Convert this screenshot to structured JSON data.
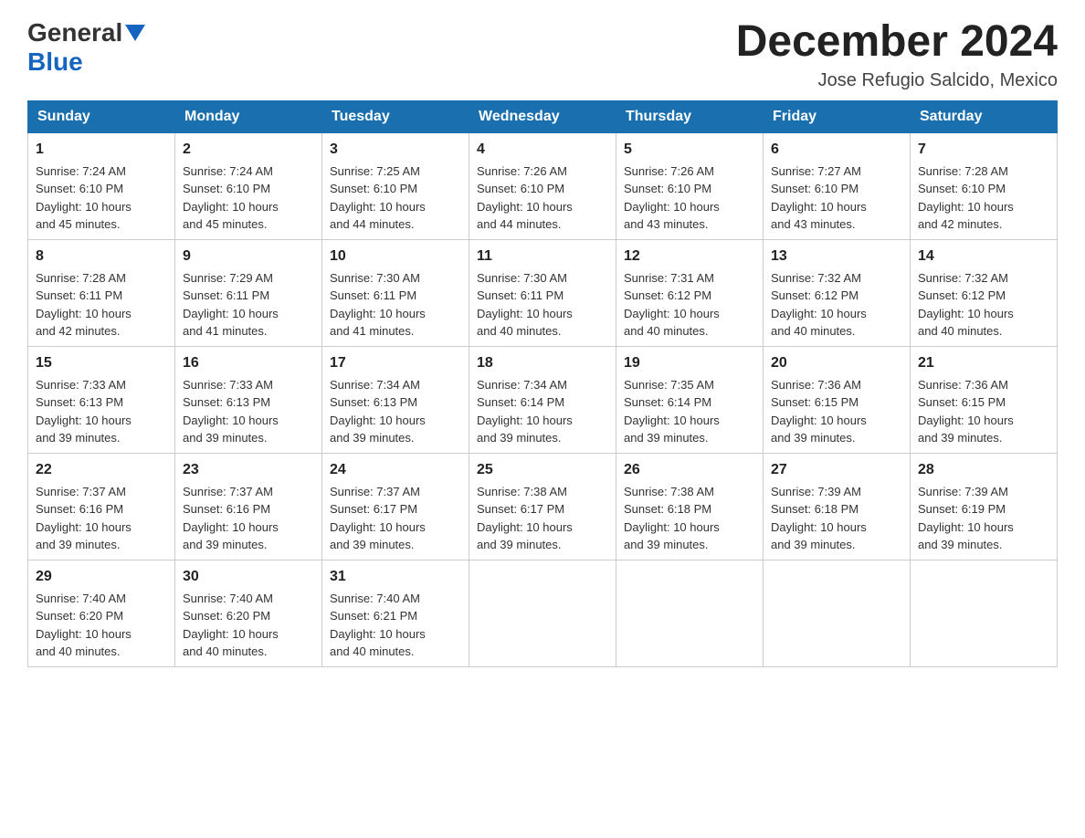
{
  "logo": {
    "general": "General",
    "blue": "Blue"
  },
  "title": "December 2024",
  "subtitle": "Jose Refugio Salcido, Mexico",
  "days_of_week": [
    "Sunday",
    "Monday",
    "Tuesday",
    "Wednesday",
    "Thursday",
    "Friday",
    "Saturday"
  ],
  "weeks": [
    [
      {
        "day": "1",
        "info": "Sunrise: 7:24 AM\nSunset: 6:10 PM\nDaylight: 10 hours\nand 45 minutes."
      },
      {
        "day": "2",
        "info": "Sunrise: 7:24 AM\nSunset: 6:10 PM\nDaylight: 10 hours\nand 45 minutes."
      },
      {
        "day": "3",
        "info": "Sunrise: 7:25 AM\nSunset: 6:10 PM\nDaylight: 10 hours\nand 44 minutes."
      },
      {
        "day": "4",
        "info": "Sunrise: 7:26 AM\nSunset: 6:10 PM\nDaylight: 10 hours\nand 44 minutes."
      },
      {
        "day": "5",
        "info": "Sunrise: 7:26 AM\nSunset: 6:10 PM\nDaylight: 10 hours\nand 43 minutes."
      },
      {
        "day": "6",
        "info": "Sunrise: 7:27 AM\nSunset: 6:10 PM\nDaylight: 10 hours\nand 43 minutes."
      },
      {
        "day": "7",
        "info": "Sunrise: 7:28 AM\nSunset: 6:10 PM\nDaylight: 10 hours\nand 42 minutes."
      }
    ],
    [
      {
        "day": "8",
        "info": "Sunrise: 7:28 AM\nSunset: 6:11 PM\nDaylight: 10 hours\nand 42 minutes."
      },
      {
        "day": "9",
        "info": "Sunrise: 7:29 AM\nSunset: 6:11 PM\nDaylight: 10 hours\nand 41 minutes."
      },
      {
        "day": "10",
        "info": "Sunrise: 7:30 AM\nSunset: 6:11 PM\nDaylight: 10 hours\nand 41 minutes."
      },
      {
        "day": "11",
        "info": "Sunrise: 7:30 AM\nSunset: 6:11 PM\nDaylight: 10 hours\nand 40 minutes."
      },
      {
        "day": "12",
        "info": "Sunrise: 7:31 AM\nSunset: 6:12 PM\nDaylight: 10 hours\nand 40 minutes."
      },
      {
        "day": "13",
        "info": "Sunrise: 7:32 AM\nSunset: 6:12 PM\nDaylight: 10 hours\nand 40 minutes."
      },
      {
        "day": "14",
        "info": "Sunrise: 7:32 AM\nSunset: 6:12 PM\nDaylight: 10 hours\nand 40 minutes."
      }
    ],
    [
      {
        "day": "15",
        "info": "Sunrise: 7:33 AM\nSunset: 6:13 PM\nDaylight: 10 hours\nand 39 minutes."
      },
      {
        "day": "16",
        "info": "Sunrise: 7:33 AM\nSunset: 6:13 PM\nDaylight: 10 hours\nand 39 minutes."
      },
      {
        "day": "17",
        "info": "Sunrise: 7:34 AM\nSunset: 6:13 PM\nDaylight: 10 hours\nand 39 minutes."
      },
      {
        "day": "18",
        "info": "Sunrise: 7:34 AM\nSunset: 6:14 PM\nDaylight: 10 hours\nand 39 minutes."
      },
      {
        "day": "19",
        "info": "Sunrise: 7:35 AM\nSunset: 6:14 PM\nDaylight: 10 hours\nand 39 minutes."
      },
      {
        "day": "20",
        "info": "Sunrise: 7:36 AM\nSunset: 6:15 PM\nDaylight: 10 hours\nand 39 minutes."
      },
      {
        "day": "21",
        "info": "Sunrise: 7:36 AM\nSunset: 6:15 PM\nDaylight: 10 hours\nand 39 minutes."
      }
    ],
    [
      {
        "day": "22",
        "info": "Sunrise: 7:37 AM\nSunset: 6:16 PM\nDaylight: 10 hours\nand 39 minutes."
      },
      {
        "day": "23",
        "info": "Sunrise: 7:37 AM\nSunset: 6:16 PM\nDaylight: 10 hours\nand 39 minutes."
      },
      {
        "day": "24",
        "info": "Sunrise: 7:37 AM\nSunset: 6:17 PM\nDaylight: 10 hours\nand 39 minutes."
      },
      {
        "day": "25",
        "info": "Sunrise: 7:38 AM\nSunset: 6:17 PM\nDaylight: 10 hours\nand 39 minutes."
      },
      {
        "day": "26",
        "info": "Sunrise: 7:38 AM\nSunset: 6:18 PM\nDaylight: 10 hours\nand 39 minutes."
      },
      {
        "day": "27",
        "info": "Sunrise: 7:39 AM\nSunset: 6:18 PM\nDaylight: 10 hours\nand 39 minutes."
      },
      {
        "day": "28",
        "info": "Sunrise: 7:39 AM\nSunset: 6:19 PM\nDaylight: 10 hours\nand 39 minutes."
      }
    ],
    [
      {
        "day": "29",
        "info": "Sunrise: 7:40 AM\nSunset: 6:20 PM\nDaylight: 10 hours\nand 40 minutes."
      },
      {
        "day": "30",
        "info": "Sunrise: 7:40 AM\nSunset: 6:20 PM\nDaylight: 10 hours\nand 40 minutes."
      },
      {
        "day": "31",
        "info": "Sunrise: 7:40 AM\nSunset: 6:21 PM\nDaylight: 10 hours\nand 40 minutes."
      },
      null,
      null,
      null,
      null
    ]
  ]
}
